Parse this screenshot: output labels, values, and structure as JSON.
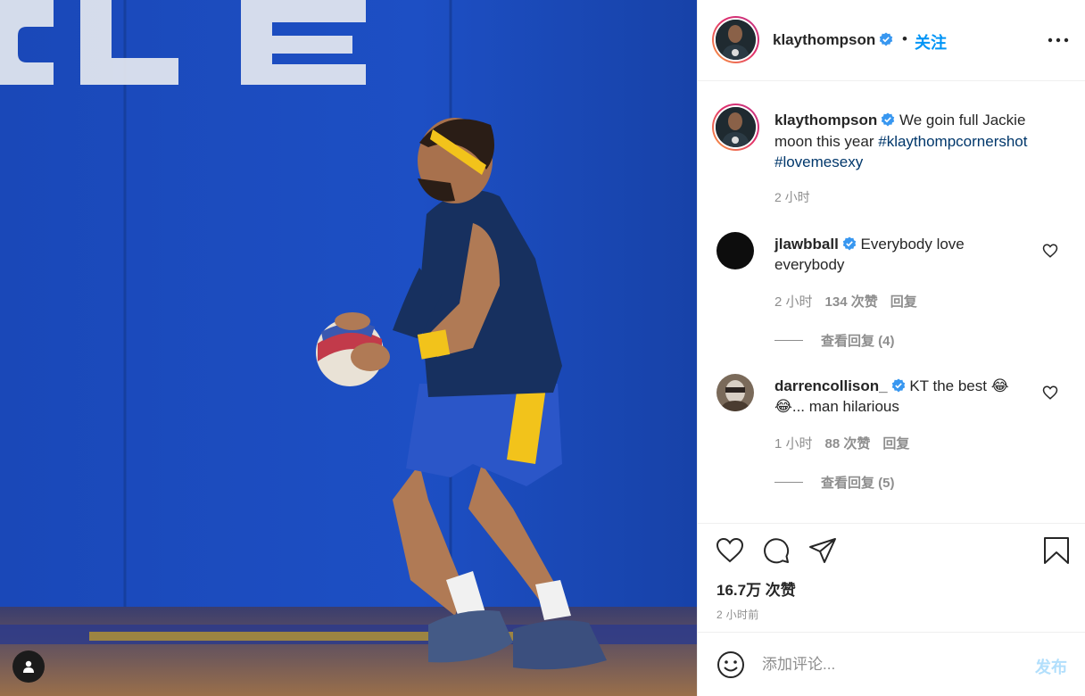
{
  "post": {
    "username": "klaythompson",
    "dot": "•",
    "follow_label": "关注",
    "more_icon": "more-horizontal-icon"
  },
  "caption": {
    "username": "klaythompson",
    "text": "We goin full Jackie moon this year ",
    "hashtags": [
      "#klaythompcornershot",
      "#lovemesexy"
    ],
    "time": "2 小时"
  },
  "comments": [
    {
      "username": "jlawbball",
      "text": "Everybody love everybody",
      "time": "2 小时",
      "likes": "134 次赞",
      "reply_label": "回复",
      "view_replies": "查看回复 (4)"
    },
    {
      "username": "darrencollison_",
      "text": "KT the best 😂😂... man hilarious",
      "time": "1 小时",
      "likes": "88 次赞",
      "reply_label": "回复",
      "view_replies": "查看回复 (5)"
    }
  ],
  "stats": {
    "likes": "16.7万 次赞",
    "posted_ago": "2 小时前"
  },
  "add_comment": {
    "placeholder": "添加评论...",
    "post_label": "发布"
  },
  "colors": {
    "accent": "#0095f6",
    "verified": "#3897f0",
    "hashtag": "#00376b",
    "muted": "#8e8e8e",
    "post_disabled": "#b2dffc"
  }
}
